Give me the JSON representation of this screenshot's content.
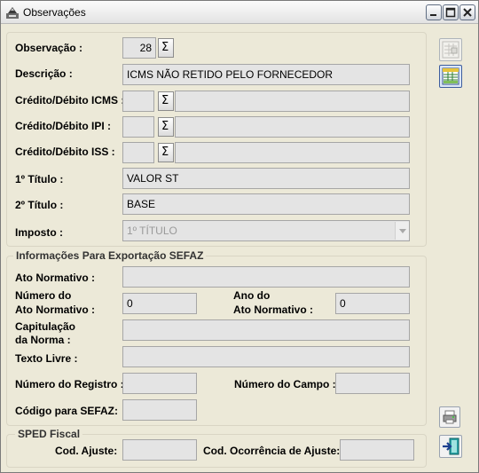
{
  "window": {
    "title": "Observações"
  },
  "form": {
    "observacao": {
      "label": "Observação :",
      "value": "28"
    },
    "descricao": {
      "label": "Descrição :",
      "value": "ICMS NÃO RETIDO PELO FORNECEDOR"
    },
    "credito_icms": {
      "label": "Crédito/Débito ICMS :",
      "code": "",
      "desc": ""
    },
    "credito_ipi": {
      "label": "Crédito/Débito IPI :",
      "code": "",
      "desc": ""
    },
    "credito_iss": {
      "label": "Crédito/Débito ISS :",
      "code": "",
      "desc": ""
    },
    "titulo1": {
      "label": "1º Título :",
      "value": "VALOR ST"
    },
    "titulo2": {
      "label": "2º Título :",
      "value": "BASE"
    },
    "imposto": {
      "label": "Imposto :",
      "value": "1º TÍTULO"
    }
  },
  "sefaz": {
    "group_title": "Informações Para Exportação SEFAZ",
    "ato_normativo": {
      "label": "Ato Normativo :",
      "value": ""
    },
    "numero_ato": {
      "label_line1": "Número do",
      "label_line2": "Ato Normativo :",
      "value": "0"
    },
    "ano_ato": {
      "label_line1": "Ano do",
      "label_line2": "Ato Normativo :",
      "value": "0"
    },
    "capitulacao": {
      "label_line1": "Capitulação",
      "label_line2": "da Norma :",
      "value": ""
    },
    "texto_livre": {
      "label": "Texto Livre :",
      "value": ""
    },
    "numero_registro": {
      "label": "Número do Registro :",
      "value": ""
    },
    "numero_campo": {
      "label": "Número do Campo :",
      "value": ""
    },
    "codigo_sefaz": {
      "label": "Código para SEFAZ:",
      "value": ""
    }
  },
  "sped": {
    "group_title": "SPED Fiscal",
    "cod_ajuste": {
      "label": "Cod. Ajuste:",
      "value": ""
    },
    "cod_ocorrencia": {
      "label": "Cod. Ocorrência de Ajuste:",
      "value": ""
    }
  },
  "lookup_glyph": "Σ",
  "icons": [
    "app-icon",
    "minimize-icon",
    "maximize-icon",
    "close-icon",
    "grid-edit-icon",
    "table-icon",
    "print-icon",
    "exit-door-icon"
  ]
}
